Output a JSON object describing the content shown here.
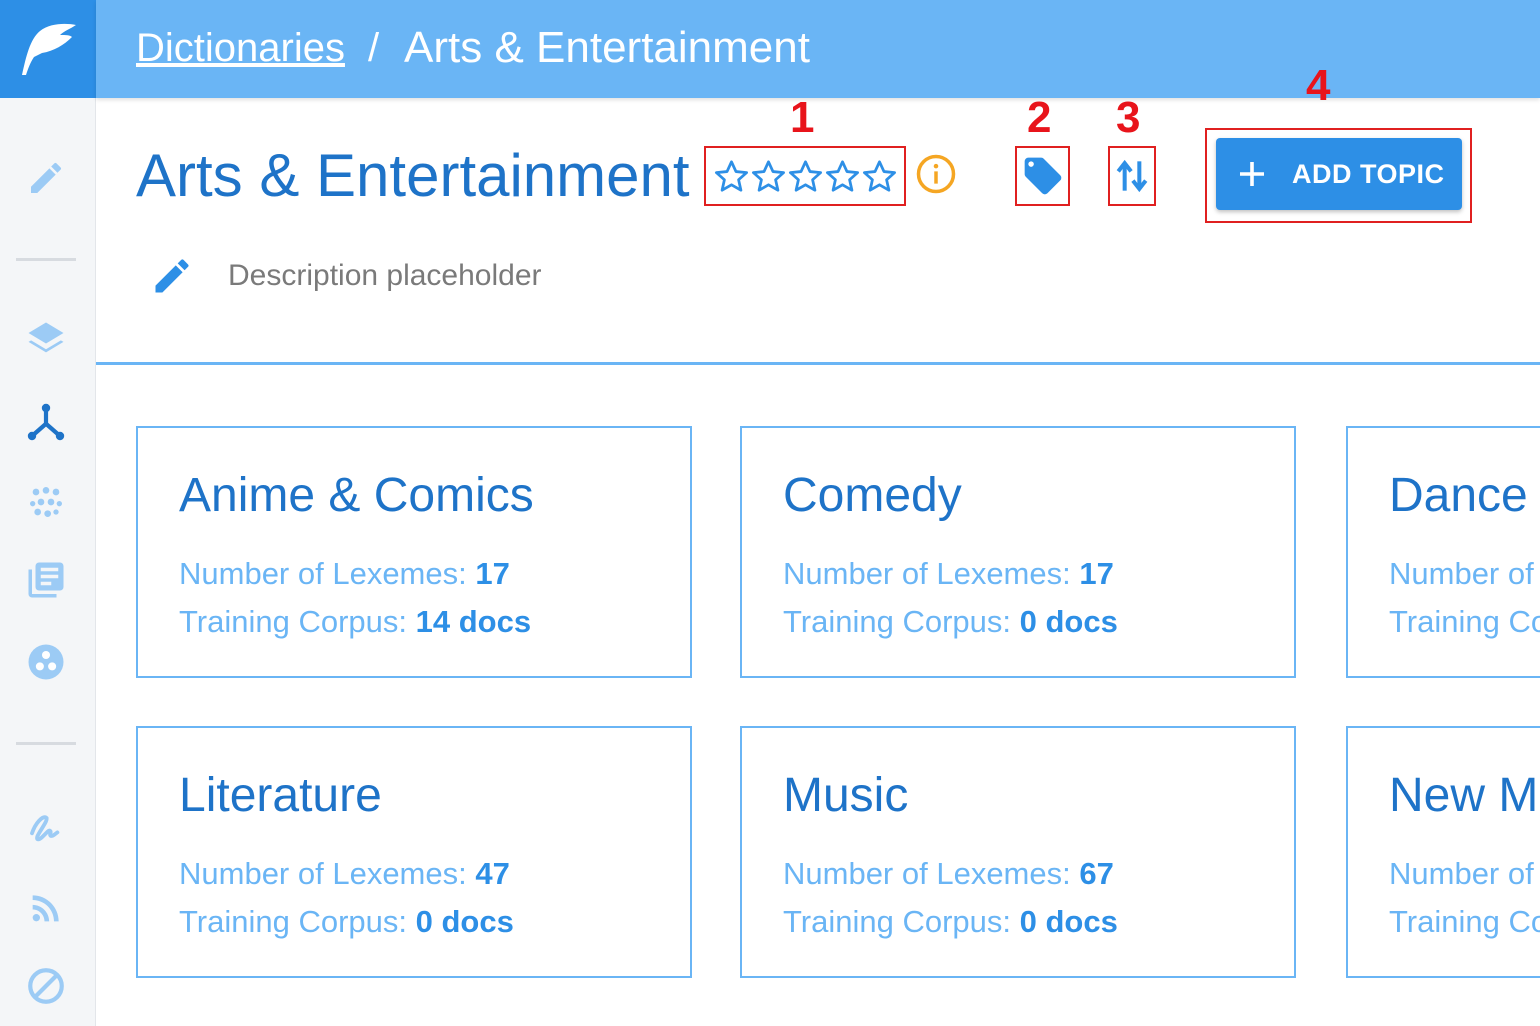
{
  "breadcrumb": {
    "parent": "Dictionaries",
    "separator": "/",
    "current": "Arts & Entertainment"
  },
  "page": {
    "title": "Arts & Entertainment",
    "rating_stars": 5,
    "rating_value": 0,
    "description_placeholder": "Description placeholder"
  },
  "toolbar": {
    "add_topic_label": "ADD TOPIC"
  },
  "callouts": [
    "1",
    "2",
    "3",
    "4"
  ],
  "card_labels": {
    "lexemes": "Number of Lexemes:",
    "corpus": "Training Corpus:"
  },
  "cards": [
    {
      "title": "Anime & Comics",
      "lexemes": "17",
      "corpus": "14 docs"
    },
    {
      "title": "Comedy",
      "lexemes": "17",
      "corpus": "0 docs"
    },
    {
      "title": "Dance",
      "lexemes": "",
      "corpus": ""
    },
    {
      "title": "Literature",
      "lexemes": "47",
      "corpus": "0 docs"
    },
    {
      "title": "Music",
      "lexemes": "67",
      "corpus": "0 docs"
    },
    {
      "title": "New Media",
      "lexemes": "",
      "corpus": ""
    }
  ],
  "colors": {
    "primary": "#2d8fe6",
    "topbar": "#6ab5f5",
    "title": "#1e73c8",
    "annotation": "#e02020",
    "info": "#f5a623"
  },
  "sidebar_icons": [
    "edit-icon",
    "layers-icon",
    "hierarchy-icon",
    "cluster-icon",
    "documents-icon",
    "group-icon",
    "signature-icon",
    "rss-icon",
    "blocked-icon"
  ]
}
